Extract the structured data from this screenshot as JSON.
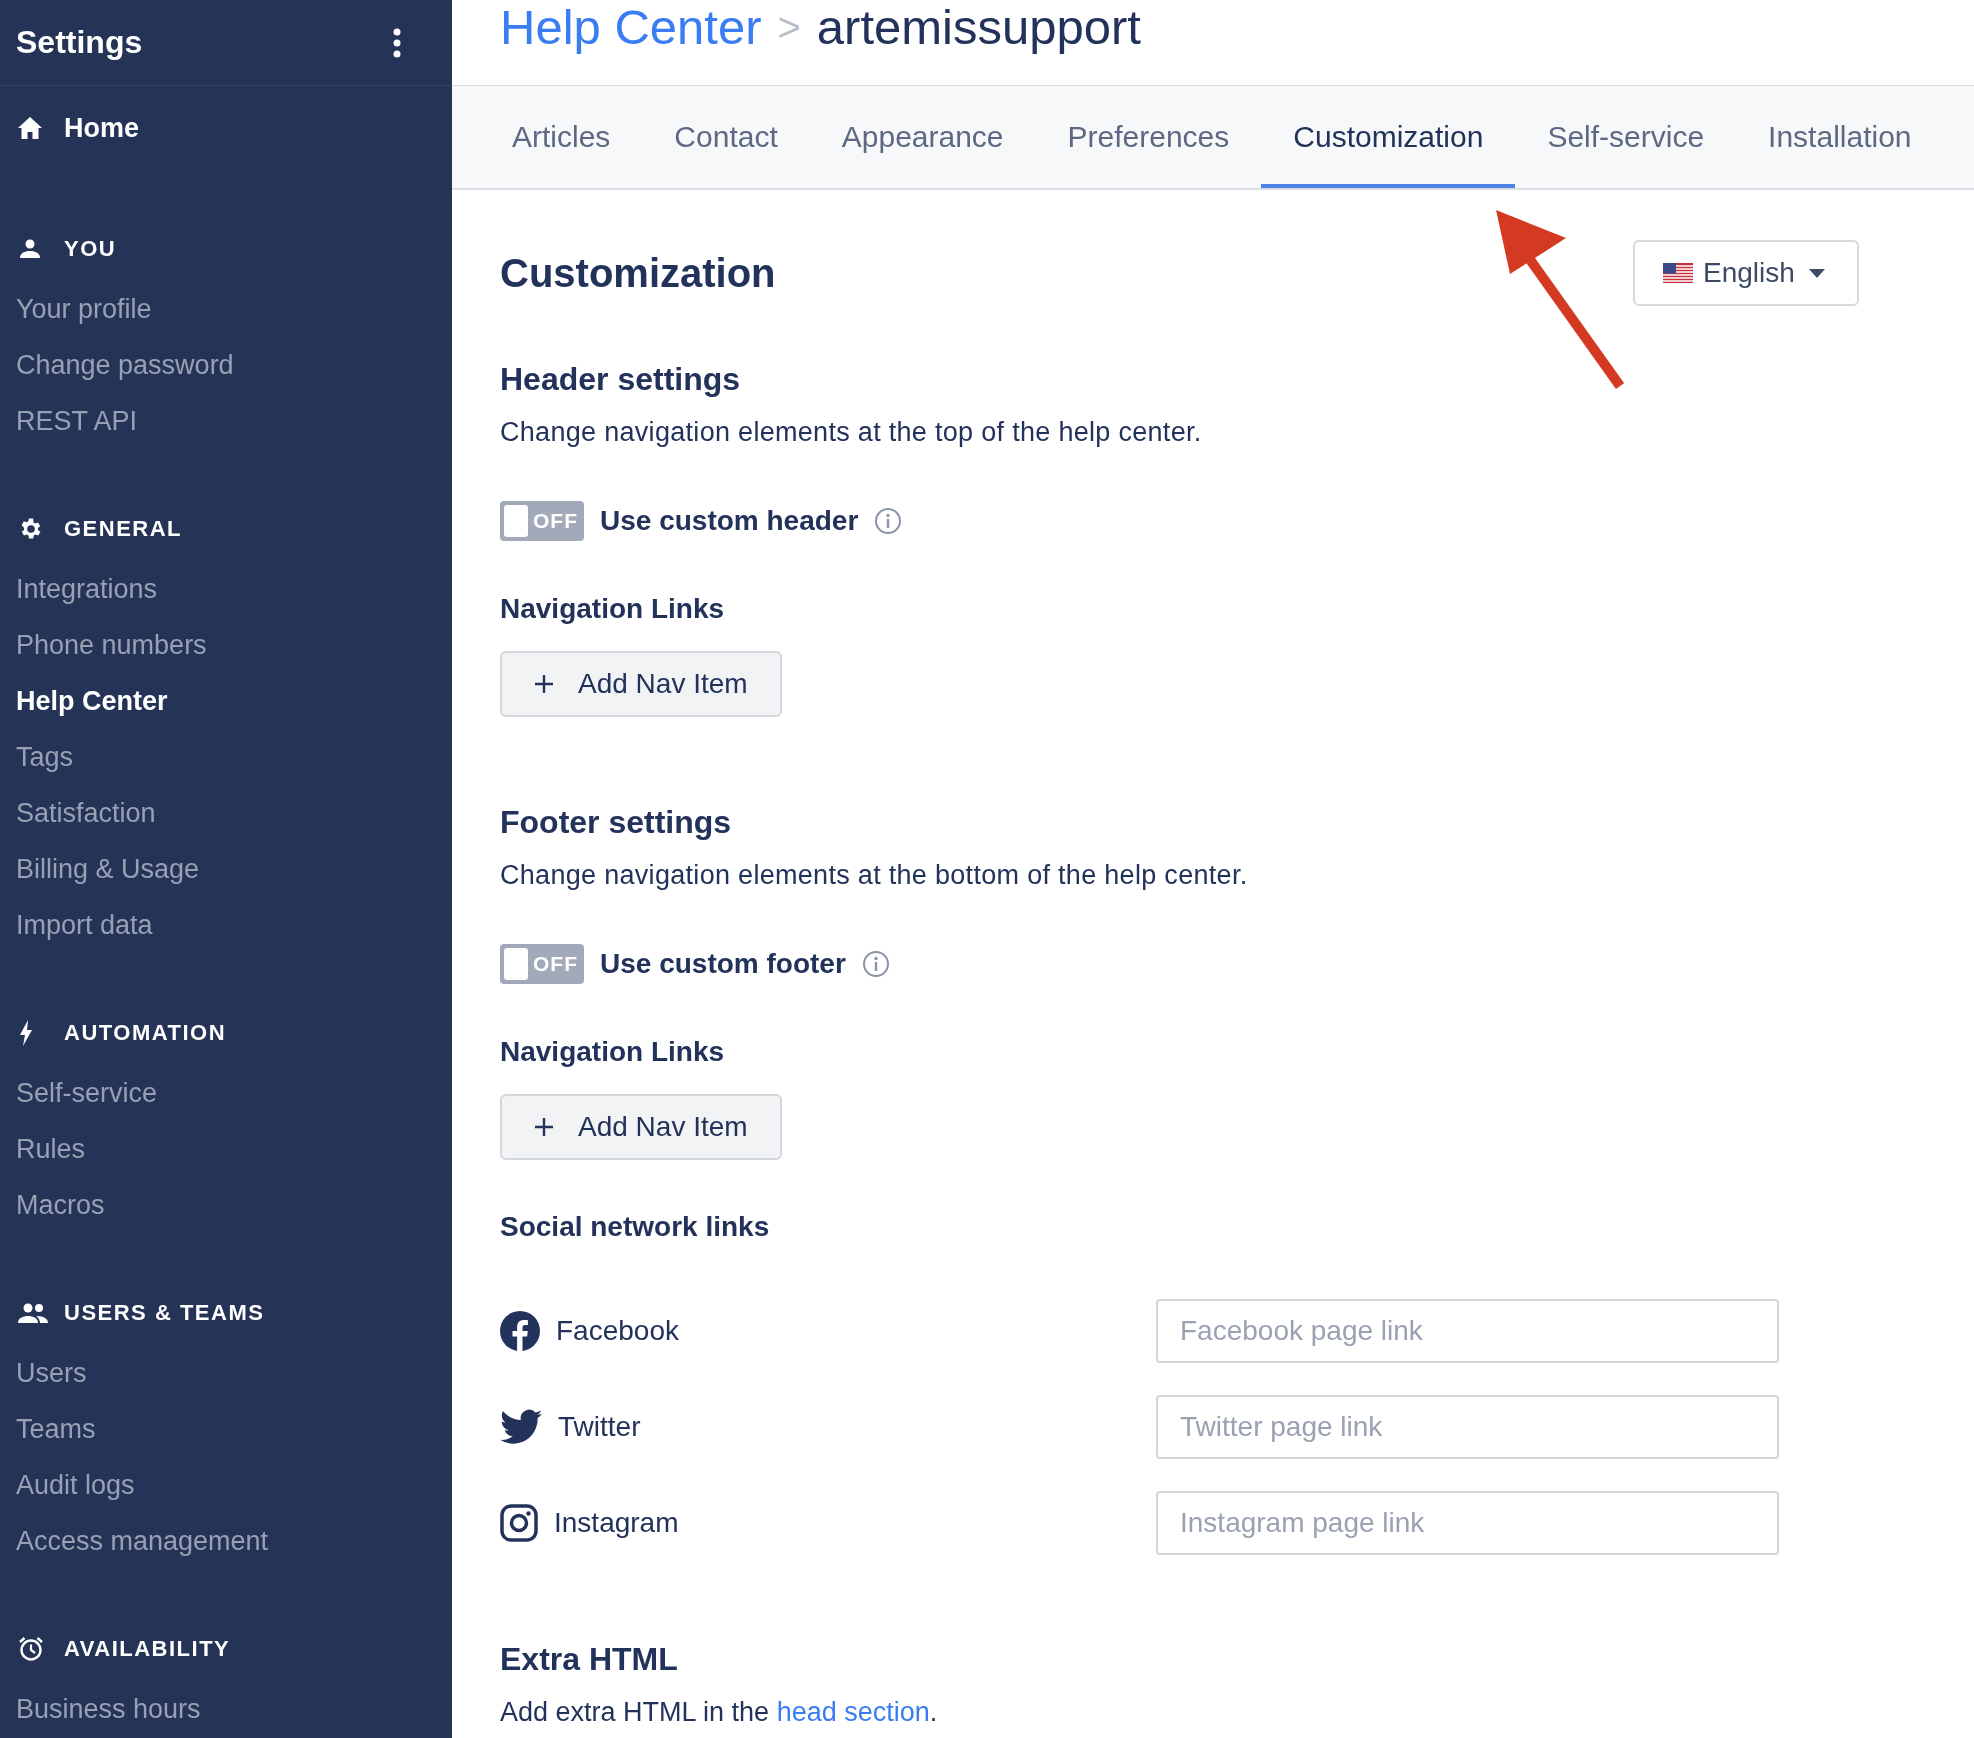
{
  "sidebar": {
    "title": "Settings",
    "home": {
      "label": "Home"
    },
    "sections": [
      {
        "heading": "YOU",
        "items": [
          {
            "label": "Your profile",
            "selected": false
          },
          {
            "label": "Change password",
            "selected": false
          },
          {
            "label": "REST API",
            "selected": false
          }
        ]
      },
      {
        "heading": "GENERAL",
        "items": [
          {
            "label": "Integrations",
            "selected": false
          },
          {
            "label": "Phone numbers",
            "selected": false
          },
          {
            "label": "Help Center",
            "selected": true
          },
          {
            "label": "Tags",
            "selected": false
          },
          {
            "label": "Satisfaction",
            "selected": false
          },
          {
            "label": "Billing & Usage",
            "selected": false
          },
          {
            "label": "Import data",
            "selected": false
          }
        ]
      },
      {
        "heading": "AUTOMATION",
        "items": [
          {
            "label": "Self-service",
            "selected": false
          },
          {
            "label": "Rules",
            "selected": false
          },
          {
            "label": "Macros",
            "selected": false
          }
        ]
      },
      {
        "heading": "USERS & TEAMS",
        "items": [
          {
            "label": "Users",
            "selected": false
          },
          {
            "label": "Teams",
            "selected": false
          },
          {
            "label": "Audit logs",
            "selected": false
          },
          {
            "label": "Access management",
            "selected": false
          }
        ]
      },
      {
        "heading": "AVAILABILITY",
        "items": [
          {
            "label": "Business hours",
            "selected": false
          }
        ]
      }
    ]
  },
  "breadcrumb": {
    "parent": "Help Center",
    "separator": ">",
    "current": "artemissupport"
  },
  "tabs": [
    {
      "label": "Articles",
      "selected": false
    },
    {
      "label": "Contact",
      "selected": false
    },
    {
      "label": "Appearance",
      "selected": false
    },
    {
      "label": "Preferences",
      "selected": false
    },
    {
      "label": "Customization",
      "selected": true
    },
    {
      "label": "Self-service",
      "selected": false
    },
    {
      "label": "Installation",
      "selected": false
    }
  ],
  "page_title": "Customization",
  "language": {
    "value": "English"
  },
  "sections": [
    {
      "title": "Header settings",
      "description": "Change navigation elements at the top of the help center.",
      "toggle": {
        "label": "Use custom header",
        "on": false,
        "state_label": "OFF"
      },
      "nav_heading": "Navigation Links",
      "button": "Add Nav Item"
    },
    {
      "title": "Footer settings",
      "description": "Change navigation elements at the bottom of the help center.",
      "toggle": {
        "label": "Use custom footer",
        "on": false,
        "state_label": "OFF"
      },
      "nav_heading": "Navigation Links",
      "button": "Add Nav Item"
    }
  ],
  "social": {
    "heading": "Social network links",
    "links": [
      {
        "kind": "facebook",
        "name": "Facebook",
        "placeholder": "Facebook page link"
      },
      {
        "kind": "twitter",
        "name": "Twitter",
        "placeholder": "Twitter page link"
      },
      {
        "kind": "instagram",
        "name": "Instagram",
        "placeholder": "Instagram page link"
      }
    ]
  },
  "extra_html": {
    "title": "Extra HTML",
    "text_before": "Add extra HTML in the ",
    "link": "head section",
    "text_after": "."
  }
}
